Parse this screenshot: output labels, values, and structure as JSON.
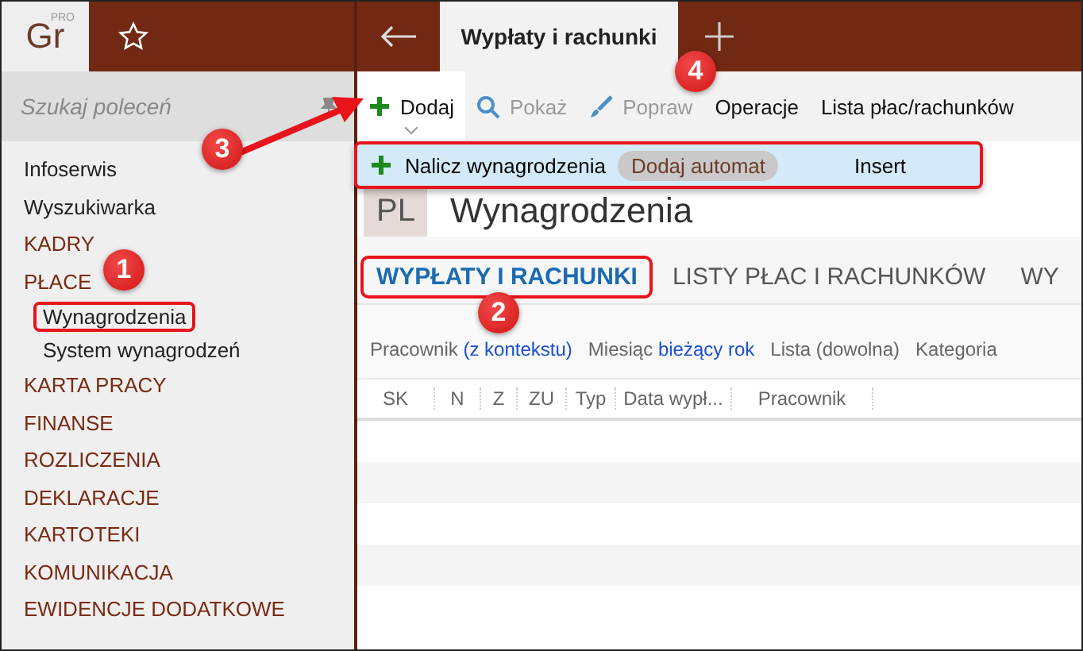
{
  "logo": {
    "text": "Gr",
    "badge": "PRO"
  },
  "search": {
    "placeholder": "Szukaj poleceń"
  },
  "tabs": [
    {
      "label": "Wypłaty i rachunki",
      "selected": true
    }
  ],
  "toolbar": [
    {
      "label": "Dodaj",
      "kind": "plus",
      "disabled": false,
      "open": true
    },
    {
      "label": "Pokaż",
      "kind": "search",
      "disabled": true,
      "open": false
    },
    {
      "label": "Popraw",
      "kind": "brush",
      "disabled": true,
      "open": false
    },
    {
      "label": "Operacje",
      "kind": "text",
      "disabled": false,
      "open": false
    },
    {
      "label": "Lista płac/rachunków",
      "kind": "text",
      "disabled": false,
      "open": false
    }
  ],
  "dropdown": {
    "annotated": true,
    "items": [
      {
        "label": "Nalicz wynagrodzenia",
        "tag": "Dodaj automat",
        "shortcut": "Insert"
      }
    ]
  },
  "sidebar": {
    "items": [
      {
        "label": "Infoserwis",
        "kind": "link",
        "annotated": false
      },
      {
        "label": "Wyszukiwarka",
        "kind": "link",
        "annotated": false
      },
      {
        "label": "KADRY",
        "kind": "section",
        "annotated": false
      },
      {
        "label": "PŁACE",
        "kind": "section",
        "annotated": false,
        "children": [
          {
            "label": "Wynagrodzenia",
            "annotated": true
          },
          {
            "label": "System wynagrodzeń",
            "annotated": false
          }
        ]
      },
      {
        "label": "KARTA PRACY",
        "kind": "section",
        "annotated": false
      },
      {
        "label": "FINANSE",
        "kind": "section",
        "annotated": false
      },
      {
        "label": "ROZLICZENIA",
        "kind": "section",
        "annotated": false
      },
      {
        "label": "DEKLARACJE",
        "kind": "section",
        "annotated": false
      },
      {
        "label": "KARTOTEKI",
        "kind": "section",
        "annotated": false
      },
      {
        "label": "KOMUNIKACJA",
        "kind": "section",
        "annotated": false
      },
      {
        "label": "EWIDENCJE DODATKOWE",
        "kind": "section",
        "annotated": false
      }
    ]
  },
  "page": {
    "badge": "PL",
    "title": "Wynagrodzenia"
  },
  "page_tabs": [
    {
      "label": "WYPŁATY I RACHUNKI",
      "selected": true,
      "annotated": true
    },
    {
      "label": "LISTY PŁAC I RACHUNKÓW",
      "selected": false,
      "annotated": false
    },
    {
      "label": "WY",
      "selected": false,
      "annotated": false
    }
  ],
  "filters": [
    {
      "label": "Pracownik",
      "value": "(z kontekstu)"
    },
    {
      "label": "Miesiąc",
      "value": "bieżący rok"
    },
    {
      "label": "Lista (dowolna)"
    },
    {
      "label": "Kategoria"
    }
  ],
  "table": {
    "columns": [
      "SK",
      "N",
      "Z",
      "ZU",
      "Typ",
      "Data wypł...",
      "Pracownik"
    ]
  },
  "annotations": [
    {
      "label": "1"
    },
    {
      "label": "2"
    },
    {
      "label": "3"
    },
    {
      "label": "4"
    }
  ]
}
